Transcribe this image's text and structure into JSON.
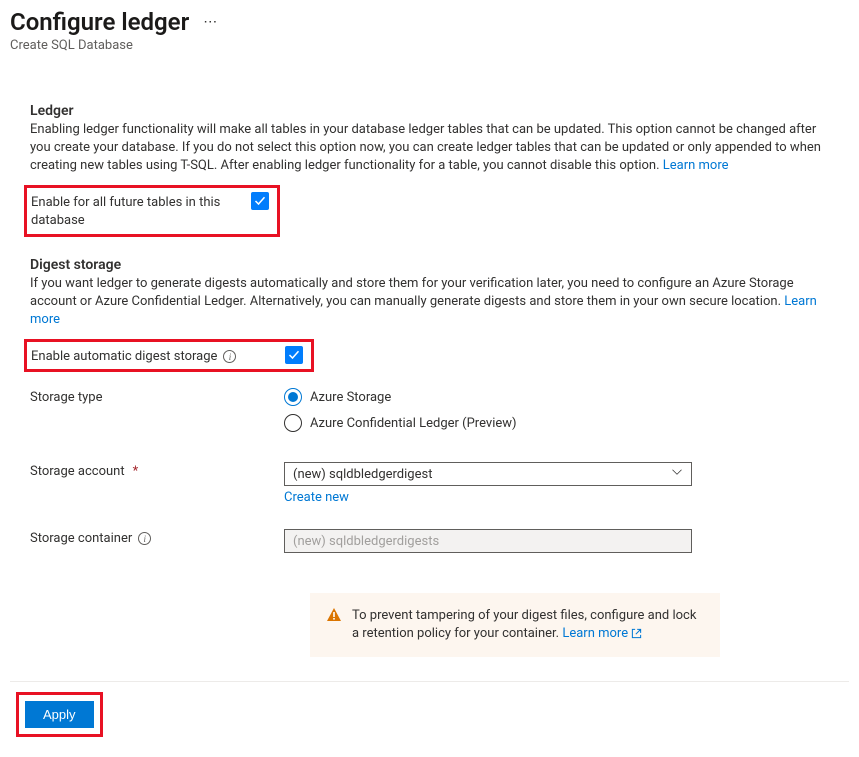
{
  "header": {
    "title": "Configure ledger",
    "subtitle": "Create SQL Database"
  },
  "ledger": {
    "title": "Ledger",
    "desc": "Enabling ledger functionality will make all tables in your database ledger tables that can be updated. This option cannot be changed after you create your database. If you do not select this option now, you can create ledger tables that can be updated or only appended to when creating new tables using T-SQL. After enabling ledger functionality for a table, you cannot disable this option.",
    "learn_more": "Learn more",
    "enable_label": "Enable for all future tables in this database"
  },
  "digest": {
    "title": "Digest storage",
    "desc": "If you want ledger to generate digests automatically and store them for your verification later, you need to configure an Azure Storage account or Azure Confidential Ledger. Alternatively, you can manually generate digests and store them in your own secure location.",
    "learn_more": "Learn more",
    "enable_label": "Enable automatic digest storage",
    "storage_type_label": "Storage type",
    "storage_type_options": {
      "azure_storage": "Azure Storage",
      "acl": "Azure Confidential Ledger (Preview)"
    },
    "storage_account_label": "Storage account",
    "storage_account_value": "(new) sqldbledgerdigest",
    "create_new": "Create new",
    "storage_container_label": "Storage container",
    "storage_container_placeholder": "(new) sqldbledgerdigests"
  },
  "warning": {
    "text": "To prevent tampering of your digest files, configure and lock a retention policy for your container.",
    "learn_more": "Learn more"
  },
  "footer": {
    "apply": "Apply"
  }
}
